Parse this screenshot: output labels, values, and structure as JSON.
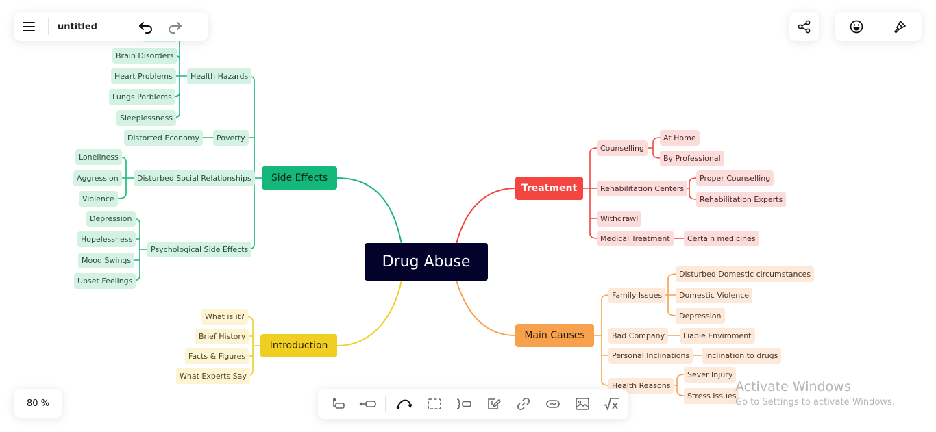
{
  "header": {
    "title": "untitled",
    "menu_icon": "hamburger-icon",
    "undo_icon": "undo-icon",
    "redo_icon": "redo-icon"
  },
  "top_right": {
    "share_icon": "share-icon",
    "emoji_icon": "smiley-icon",
    "style_icon": "paintbrush-icon"
  },
  "zoom_level": "80 %",
  "toolbar": {
    "items": [
      {
        "name": "add-child-node",
        "icon": "child-node-icon"
      },
      {
        "name": "add-sibling-node",
        "icon": "sibling-node-icon"
      },
      {
        "name": "relationship",
        "icon": "curved-arrow-icon"
      },
      {
        "name": "boundary",
        "icon": "dashed-rectangle-icon"
      },
      {
        "name": "summary",
        "icon": "summary-brace-icon"
      },
      {
        "name": "note",
        "icon": "note-edit-icon"
      },
      {
        "name": "link",
        "icon": "link-icon"
      },
      {
        "name": "label",
        "icon": "label-icon"
      },
      {
        "name": "image",
        "icon": "image-icon"
      },
      {
        "name": "formula",
        "icon": "formula-icon"
      }
    ]
  },
  "colors": {
    "green": "#14b87b",
    "red": "#f44640",
    "orange": "#f7a14d",
    "yellow": "#f0cf22",
    "root": "#02022b"
  },
  "mindmap": {
    "root": "Drug Abuse",
    "side_effects": {
      "label": "Side Effects",
      "health_hazards": {
        "label": "Health Hazards",
        "children": [
          "Brain Disorders",
          "Heart Problems",
          "Lungs Porblems",
          "Sleeplessness"
        ]
      },
      "poverty": {
        "label": "Poverty",
        "children": [
          "Distorted Economy"
        ]
      },
      "social": {
        "label": "Disturbed Social Relationships",
        "children": [
          "Loneliness",
          "Aggression",
          "Violence"
        ]
      },
      "psych": {
        "label": "Psychological Side Effects",
        "children": [
          "Depression",
          "Hopelessness",
          "Mood Swings",
          "Upset Feelings"
        ]
      }
    },
    "treatment": {
      "label": "Treatment",
      "counselling": {
        "label": "Counselling",
        "children": [
          "At Home",
          "By Professional"
        ]
      },
      "rehab": {
        "label": "Rehabilitation Centers",
        "children": [
          "Proper Counselling",
          "Rehabilitation Experts"
        ]
      },
      "withdrawl": {
        "label": "Withdrawl"
      },
      "medical": {
        "label": "Medical Treatment",
        "children": [
          "Certain medicines"
        ]
      }
    },
    "main_causes": {
      "label": "Main Causes",
      "family": {
        "label": "Family Issues",
        "children": [
          "Disturbed Domestic circumstances",
          "Domestic Violence",
          "Depression"
        ]
      },
      "bad_company": {
        "label": "Bad Company",
        "children": [
          "Liable Enviroment"
        ]
      },
      "personal": {
        "label": "Personal Inclinations",
        "children": [
          "Inclination to drugs"
        ]
      },
      "health": {
        "label": "Health Reasons",
        "children": [
          "Sever Injury",
          "Stress Issues"
        ]
      }
    },
    "introduction": {
      "label": "Introduction",
      "children": [
        "What is it?",
        "Brief History",
        "Facts & Figures",
        "What Experts Say"
      ]
    }
  },
  "watermark": {
    "line1": "Activate Windows",
    "line2": "Go to Settings to activate Windows."
  }
}
